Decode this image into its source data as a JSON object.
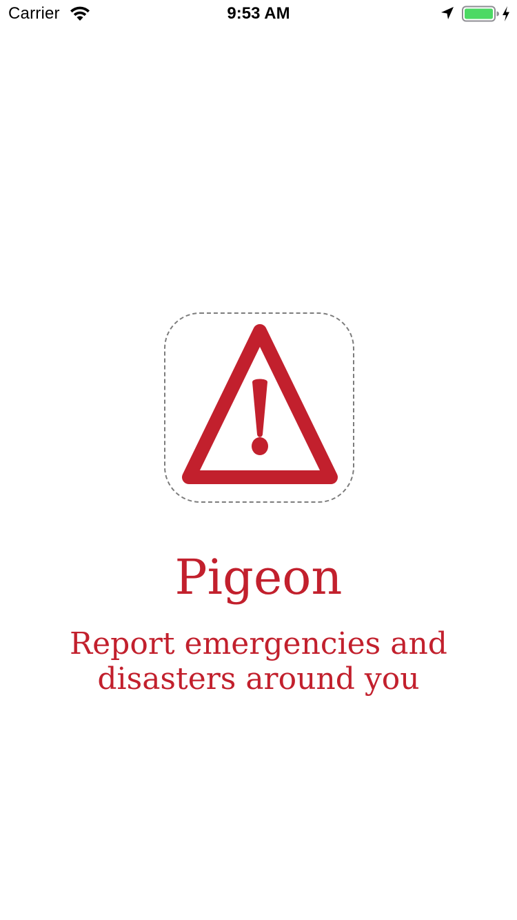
{
  "status_bar": {
    "carrier": "Carrier",
    "time": "9:53 AM",
    "wifi_icon": "wifi-icon",
    "location_icon": "location-arrow-icon",
    "battery_icon": "battery-icon",
    "battery_level": 1.0,
    "battery_color": "#4cd964",
    "charging_icon": "charging-bolt-icon"
  },
  "splash": {
    "logo_icon": "warning-triangle-icon",
    "accent_color": "#c2202d",
    "title": "Pigeon",
    "tagline": "Report emergencies and disasters around you"
  }
}
